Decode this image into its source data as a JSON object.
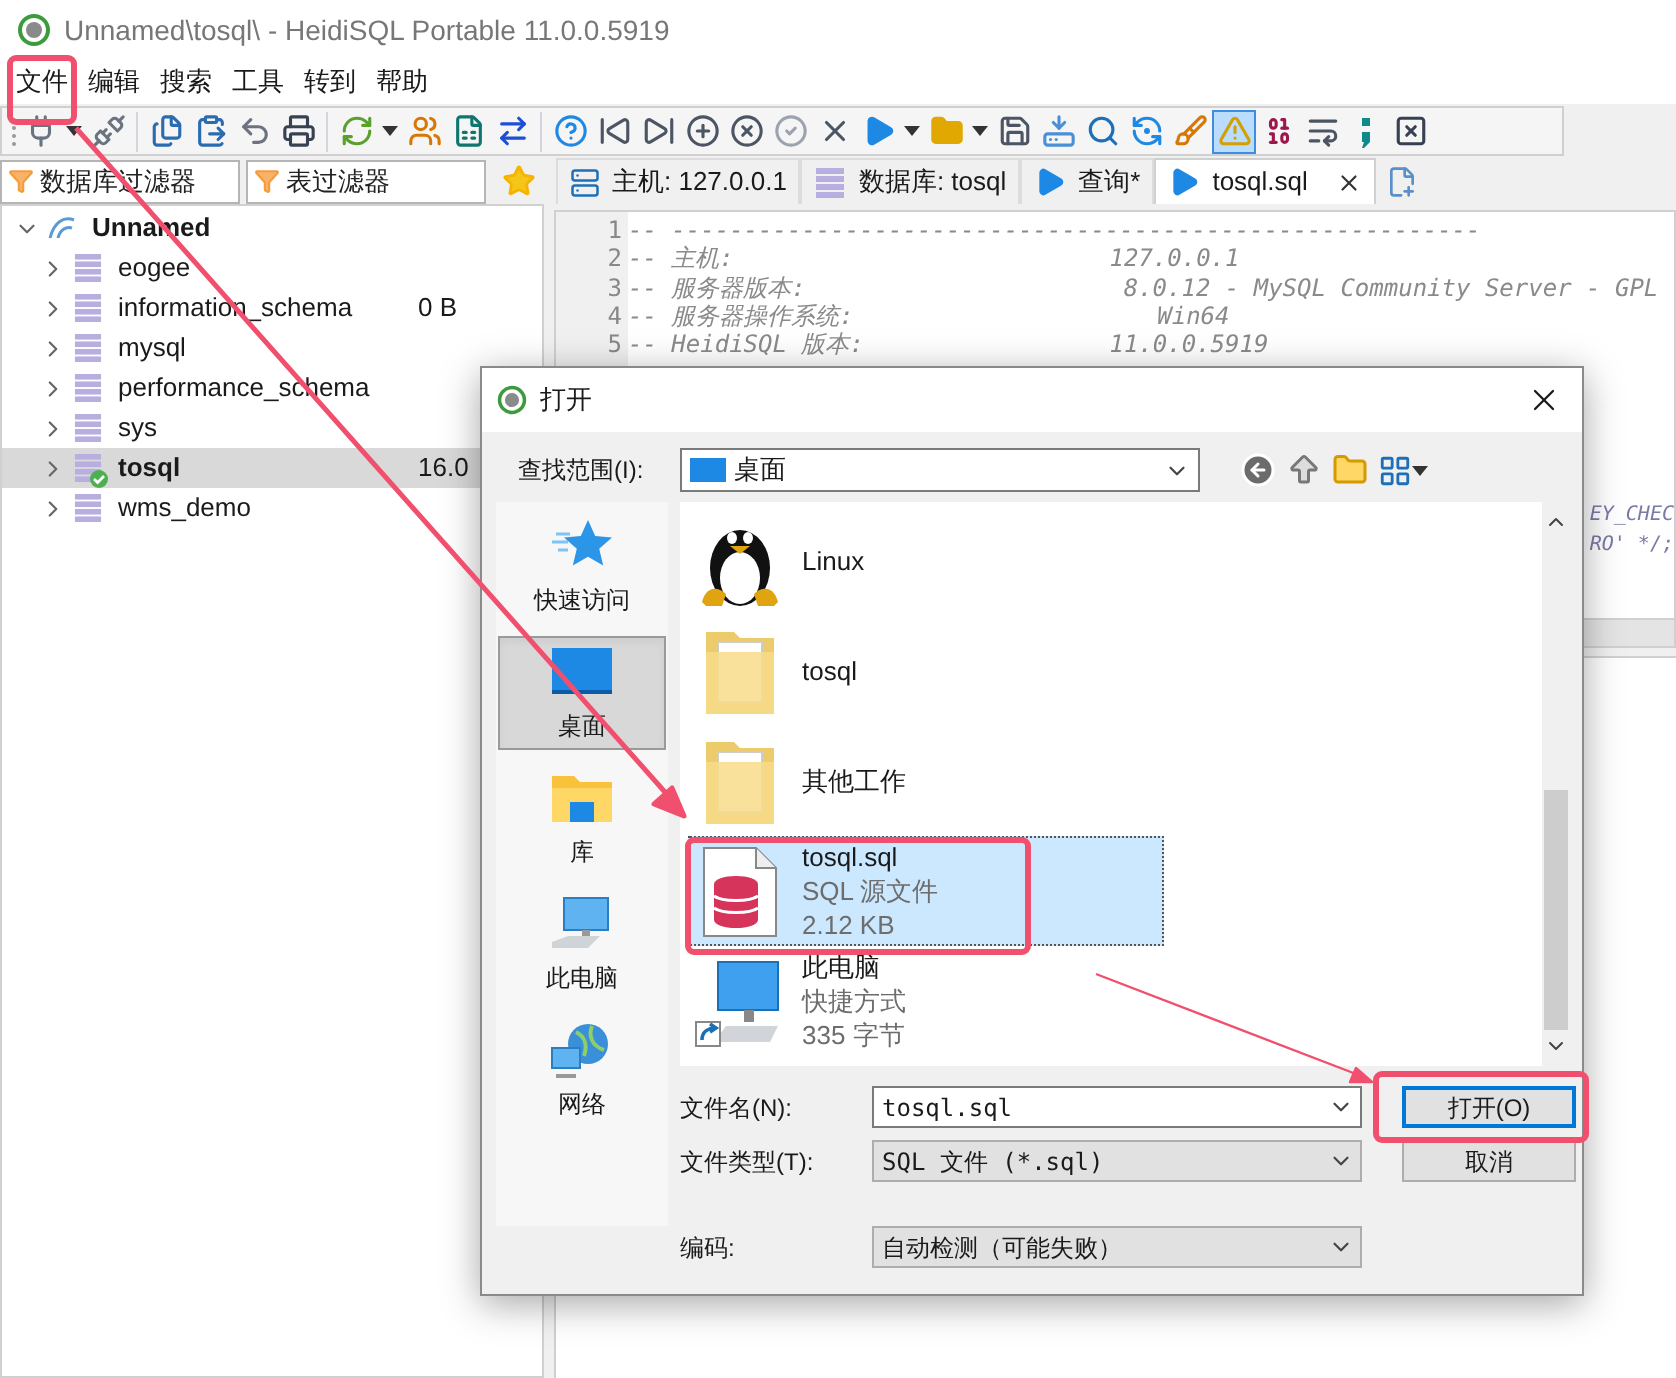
{
  "window": {
    "title": "Unnamed\\tosql\\ - HeidiSQL Portable 11.0.0.5919"
  },
  "menu": [
    {
      "label": "文件"
    },
    {
      "label": "编辑"
    },
    {
      "label": "搜索"
    },
    {
      "label": "工具"
    },
    {
      "label": "转到"
    },
    {
      "label": "帮助"
    }
  ],
  "toolbar": [
    {
      "kind": "connect"
    },
    {
      "kind": "dropdown"
    },
    {
      "kind": "disconnect"
    },
    {
      "kind": "separator"
    },
    {
      "kind": "copy"
    },
    {
      "kind": "paste"
    },
    {
      "kind": "undo"
    },
    {
      "kind": "print"
    },
    {
      "kind": "separator"
    },
    {
      "kind": "refresh"
    },
    {
      "kind": "dropdown"
    },
    {
      "kind": "users"
    },
    {
      "kind": "csv"
    },
    {
      "kind": "export"
    },
    {
      "kind": "separator"
    },
    {
      "kind": "help"
    },
    {
      "kind": "first"
    },
    {
      "kind": "last"
    },
    {
      "kind": "add"
    },
    {
      "kind": "remove"
    },
    {
      "kind": "ok"
    },
    {
      "kind": "cancel"
    },
    {
      "kind": "run"
    },
    {
      "kind": "dropdown"
    },
    {
      "kind": "folder"
    },
    {
      "kind": "dropdown"
    },
    {
      "kind": "save"
    },
    {
      "kind": "saveas"
    },
    {
      "kind": "search"
    },
    {
      "kind": "replace"
    },
    {
      "kind": "clean"
    },
    {
      "kind": "warning",
      "pressed": true
    },
    {
      "kind": "binary",
      "pressed": false
    },
    {
      "kind": "wrap",
      "pressed": false
    },
    {
      "kind": "semicolon",
      "pressed": false
    },
    {
      "kind": "close"
    }
  ],
  "filters": [
    {
      "placeholder": "数据库过滤器"
    },
    {
      "placeholder": "表过滤器"
    }
  ],
  "tree": [
    {
      "label": "Unnamed",
      "expanded": true,
      "children": [
        {
          "label": "eogee",
          "expanded": false,
          "selected": false,
          "active": false
        },
        {
          "label": "information_schema",
          "size": "0 B",
          "expanded": false,
          "selected": false,
          "active": false
        },
        {
          "label": "mysql",
          "expanded": false,
          "selected": false,
          "active": false
        },
        {
          "label": "performance_schema",
          "expanded": false,
          "selected": false,
          "active": false
        },
        {
          "label": "sys",
          "expanded": false,
          "selected": false,
          "active": false
        },
        {
          "label": "tosql",
          "size": "16.0",
          "expanded": false,
          "selected": true,
          "active": true
        },
        {
          "label": "wms_demo",
          "expanded": false,
          "selected": false,
          "active": false
        }
      ]
    }
  ],
  "tabs": [
    {
      "label": "主机: 127.0.0.1",
      "kind": "host",
      "selected": false,
      "closable": false
    },
    {
      "label": "数据库: tosql",
      "kind": "database",
      "selected": false,
      "closable": false
    },
    {
      "label": "查询*",
      "kind": "query",
      "selected": false,
      "closable": false
    },
    {
      "label": "tosql.sql",
      "kind": "query",
      "selected": true,
      "closable": true
    }
  ],
  "editor": {
    "lines": [
      {
        "number": "1",
        "text": "-- --------------------------------------------------------"
      },
      {
        "number": "2",
        "text": "-- 主机:                          127.0.0.1"
      },
      {
        "number": "3",
        "text": "-- 服务器版本:                      8.0.12 - MySQL Community Server - GPL"
      },
      {
        "number": "4",
        "text": "-- 服务器操作系统:                     Win64"
      },
      {
        "number": "5",
        "text": "-- HeidiSQL 版本:                 11.0.0.5919"
      }
    ],
    "cut_fragments": [
      "EY_CHEC",
      "RO' */;"
    ]
  },
  "dialog": {
    "title": "打开",
    "look_in": {
      "label": "查找范围(I):",
      "value": "桌面"
    },
    "places": [
      {
        "label": "快速访问",
        "kind": "quick",
        "selected": false
      },
      {
        "label": "桌面",
        "kind": "desktop",
        "selected": true
      },
      {
        "label": "库",
        "kind": "library",
        "selected": false
      },
      {
        "label": "此电脑",
        "kind": "computer",
        "selected": false
      },
      {
        "label": "网络",
        "kind": "network",
        "selected": false
      }
    ],
    "files": [
      {
        "name": "Linux",
        "kind": "penguin",
        "selected": false
      },
      {
        "name": "tosql",
        "kind": "folder",
        "selected": false
      },
      {
        "name": "其他工作",
        "kind": "folder",
        "selected": false
      },
      {
        "name": "tosql.sql",
        "type": "SQL 源文件",
        "size": "2.12 KB",
        "kind": "sql",
        "selected": true
      },
      {
        "name": "此电脑",
        "type": "快捷方式",
        "size": "335 字节",
        "kind": "shortcut",
        "selected": false
      }
    ],
    "fields": [
      {
        "label": "文件名(N):",
        "value": "tosql.sql",
        "editable": true
      },
      {
        "label": "文件类型(T):",
        "value": "SQL 文件 (*.sql)",
        "editable": false
      },
      {
        "label": "编码:",
        "value": "自动检测（可能失败）",
        "editable": false
      }
    ],
    "buttons": [
      {
        "label": "打开(O)",
        "default": true
      },
      {
        "label": "取消",
        "default": false
      }
    ]
  }
}
